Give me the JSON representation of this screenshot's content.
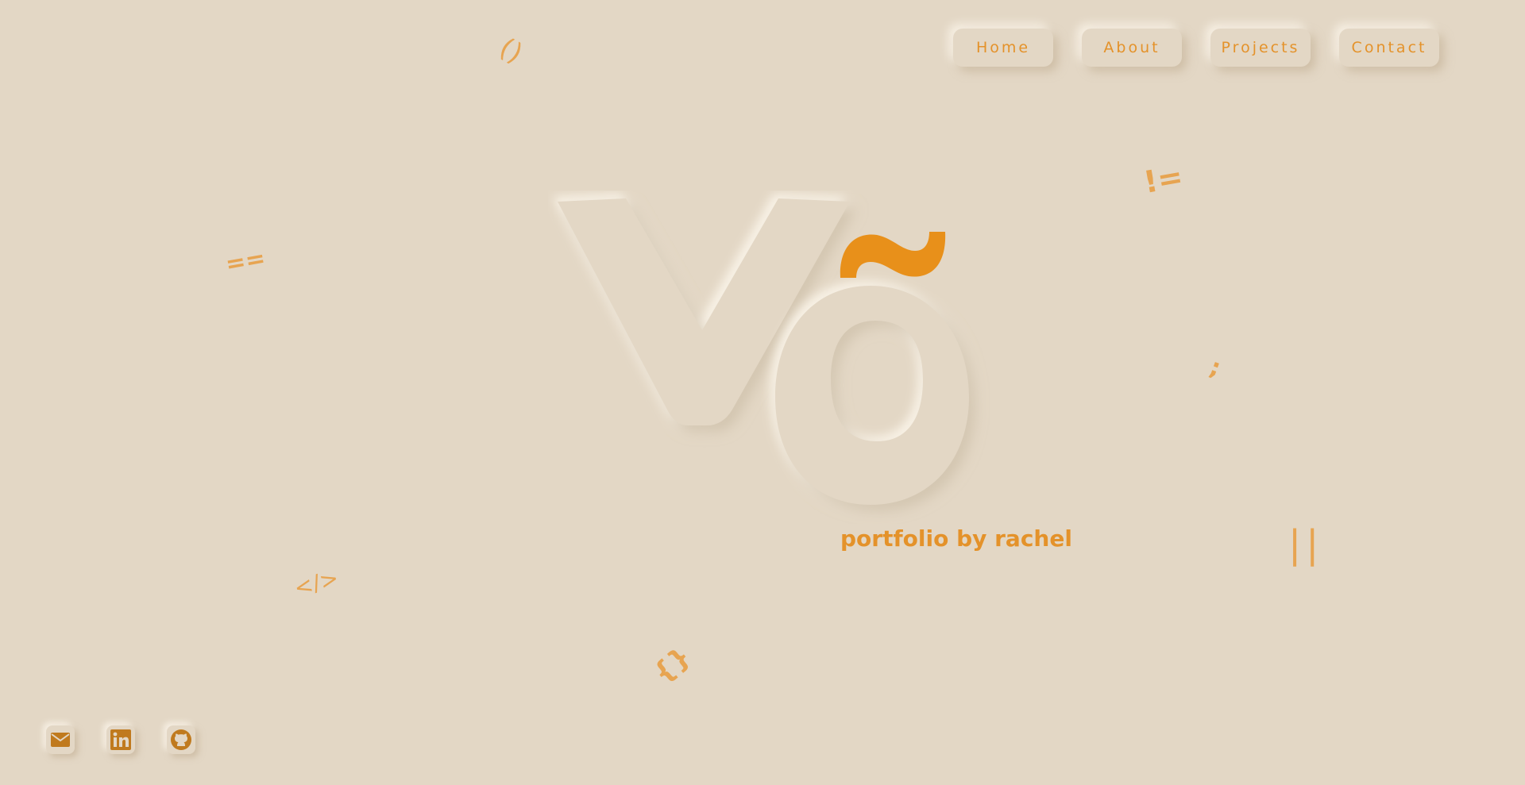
{
  "nav": {
    "items": [
      {
        "label": "Home"
      },
      {
        "label": "About"
      },
      {
        "label": "Projects"
      },
      {
        "label": "Contact"
      }
    ]
  },
  "hero": {
    "logo_text": "Võ",
    "tagline": "portfolio by rachel"
  },
  "decor": {
    "symbols": [
      "()",
      "!=",
      "==",
      ";",
      "</>",
      "||",
      "{}"
    ]
  },
  "social": {
    "items": [
      {
        "icon": "email-icon"
      },
      {
        "icon": "linkedin-icon"
      },
      {
        "icon": "github-icon"
      }
    ]
  },
  "colors": {
    "background": "#e3d7c5",
    "accent": "#e4922a",
    "icon_dark": "#c07a1e"
  }
}
